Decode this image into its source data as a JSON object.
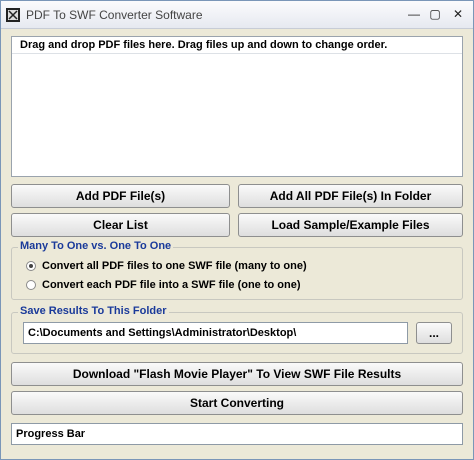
{
  "window": {
    "title": "PDF To SWF Converter Software",
    "min_glyph": "—",
    "max_glyph": "▢",
    "close_glyph": "✕"
  },
  "drop_list": {
    "header": "Drag and drop PDF files here. Drag files up and down to change order."
  },
  "buttons": {
    "add_files": "Add PDF File(s)",
    "add_all": "Add All PDF File(s) In Folder",
    "clear_list": "Clear List",
    "load_sample": "Load Sample/Example Files",
    "browse": "...",
    "download_player": "Download \"Flash Movie Player\" To View SWF File Results",
    "start": "Start Converting"
  },
  "mode_group": {
    "label": "Many To One vs. One To One",
    "option_many": "Convert all PDF files to one SWF file (many to one)",
    "option_one": "Convert each PDF file into a SWF file (one to one)",
    "selected": "many"
  },
  "save_group": {
    "label": "Save Results To This Folder",
    "path": "C:\\Documents and Settings\\Administrator\\Desktop\\"
  },
  "progress": {
    "label": "Progress Bar"
  }
}
